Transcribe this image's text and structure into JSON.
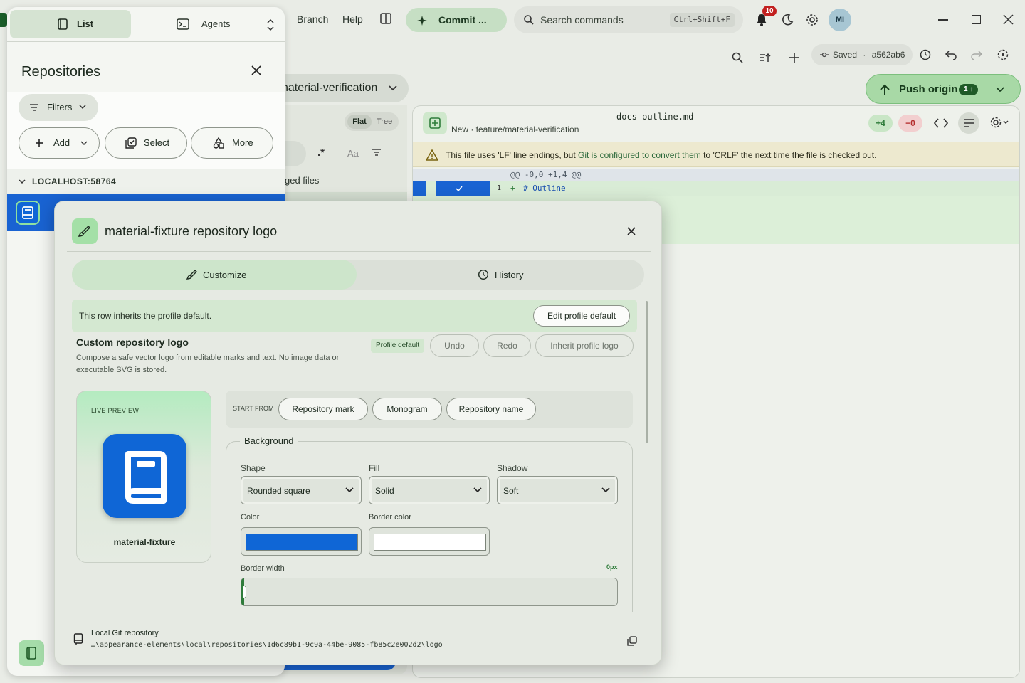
{
  "topbar": {
    "menu_branch": "Branch",
    "menu_help": "Help",
    "commit_label": "Commit ...",
    "search_placeholder": "Search commands",
    "search_shortcut": "Ctrl+Shift+F",
    "notifications_count": "10",
    "avatar_initials": "MI"
  },
  "toolbar": {
    "saved_label": "Saved",
    "saved_hash": "a562ab6",
    "branch_name": "naterial-verification",
    "push_label": "Push origin",
    "push_count": "1"
  },
  "changes": {
    "view_flat": "Flat",
    "view_tree": "Tree",
    "regex_label": ".*",
    "case_label": "Aa",
    "staged_label": "ged files"
  },
  "diff": {
    "file_name": "docs-outline.md",
    "file_status": "New · feature/material-verification",
    "additions": "+4",
    "deletions": "−0",
    "warning_pre": "This file uses 'LF' line endings, but ",
    "warning_link": "Git is configured to convert them",
    "warning_post": " to 'CRLF' the next time the file is checked out.",
    "hunk_header": "@@ -0,0 +1,4 @@",
    "line_number": "1",
    "line_prefix": "+",
    "line_text": "# Outline"
  },
  "repo_panel": {
    "tab_list": "List",
    "tab_agents": "Agents",
    "title": "Repositories",
    "filters_label": "Filters",
    "add_label": "Add",
    "select_label": "Select",
    "more_label": "More",
    "host_header": "LOCALHOST:58764"
  },
  "dialog": {
    "title": "material-fixture repository logo",
    "tab_customize": "Customize",
    "tab_history": "History",
    "inherit_text": "This row inherits the profile default.",
    "edit_default_label": "Edit profile default",
    "section_title": "Custom repository logo",
    "section_desc": "Compose a safe vector logo from editable marks and text. No image data or executable SVG is stored.",
    "profile_badge": "Profile default",
    "undo_label": "Undo",
    "redo_label": "Redo",
    "inherit_logo_label": "Inherit profile logo",
    "preview_caption": "LIVE PREVIEW",
    "preview_name": "material-fixture",
    "start_from_label": "START FROM",
    "start_options": [
      "Repository mark",
      "Monogram",
      "Repository name"
    ],
    "background_legend": "Background",
    "shape_label": "Shape",
    "shape_value": "Rounded square",
    "fill_label": "Fill",
    "fill_value": "Solid",
    "shadow_label": "Shadow",
    "shadow_value": "Soft",
    "color_label": "Color",
    "color_value": "#0f66d6",
    "border_color_label": "Border color",
    "border_color_value": "#ffffff",
    "border_width_label": "Border width",
    "border_width_value": "0px",
    "footer_title": "Local Git repository",
    "footer_path": "…\\appearance-elements\\local\\repositories\\1d6c89b1-9c9a-44be-9085-fb85c2e002d2\\logo"
  },
  "colors": {
    "accent": "#2f7c3b",
    "logo_bg": "#0f66d6",
    "selected_row": "#1963d2",
    "notification": "#c21f1f"
  }
}
